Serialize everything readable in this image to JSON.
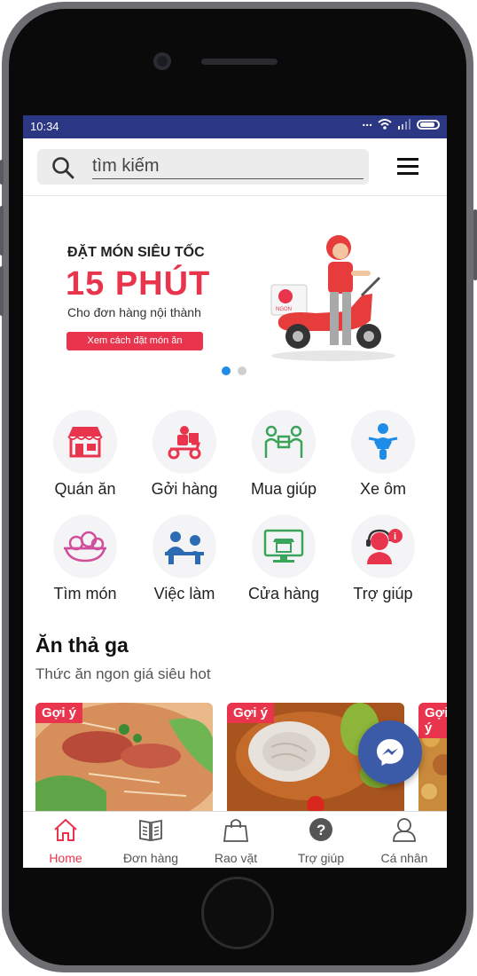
{
  "status": {
    "time": "10:34",
    "dots": "..."
  },
  "search": {
    "placeholder": "tìm kiếm"
  },
  "banner": {
    "line1": "ĐẶT MÓN SIÊU TỐC",
    "line2": "15 PHÚT",
    "line3": "Cho đơn hàng nội thành",
    "button": "Xem cách đặt món ăn",
    "scooter_label": "NGON",
    "slide_count": 2,
    "active_slide": 1
  },
  "categories": [
    {
      "label": "Quán ăn",
      "icon": "store-icon"
    },
    {
      "label": "Gởi hàng",
      "icon": "delivery-scooter-icon"
    },
    {
      "label": "Mua giúp",
      "icon": "shopping-help-icon"
    },
    {
      "label": "Xe ôm",
      "icon": "motorbike-rider-icon"
    },
    {
      "label": "Tìm món",
      "icon": "food-dish-icon"
    },
    {
      "label": "Việc làm",
      "icon": "jobs-icon"
    },
    {
      "label": "Cửa hàng",
      "icon": "shop-monitor-icon"
    },
    {
      "label": "Trợ giúp",
      "icon": "support-agent-icon"
    }
  ],
  "section": {
    "title": "Ăn thả ga",
    "subtitle": "Thức ăn ngon giá siêu hot",
    "cards": [
      {
        "tag": "Gợi ý"
      },
      {
        "tag": "Gợi ý"
      },
      {
        "tag": "Gợi ý"
      }
    ]
  },
  "tabs": [
    {
      "label": "Home",
      "icon": "home-icon",
      "active": true
    },
    {
      "label": "Đơn hàng",
      "icon": "book-icon"
    },
    {
      "label": "Rao vặt",
      "icon": "shopping-bag-icon"
    },
    {
      "label": "Trợ giúp",
      "icon": "help-circle-icon"
    },
    {
      "label": "Cá nhân",
      "icon": "user-icon"
    }
  ],
  "colors": {
    "accent": "#e8354d",
    "statusbar": "#2c3783",
    "messenger": "#3b5aa8",
    "dot_active": "#1f8ce6"
  }
}
